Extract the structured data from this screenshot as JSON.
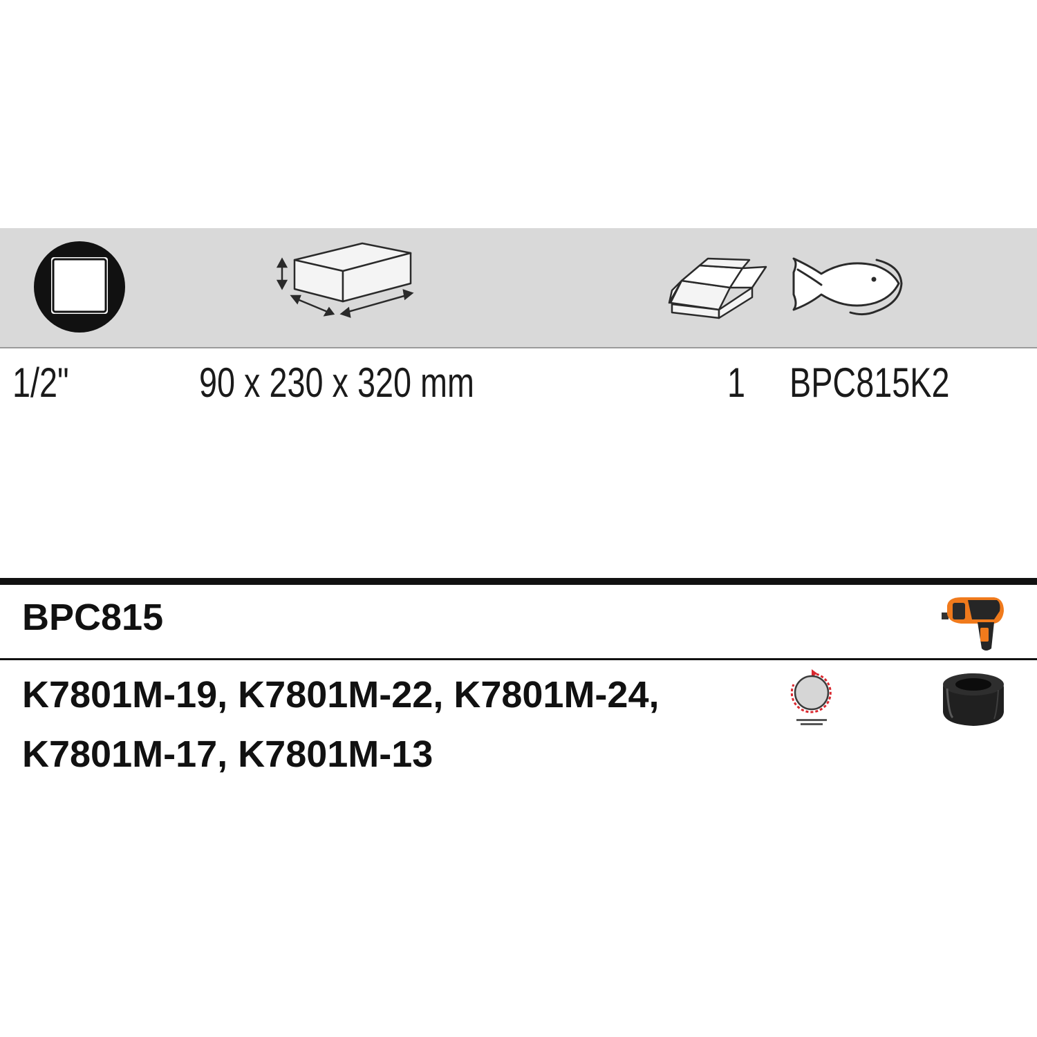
{
  "specs": {
    "drive_size": "1/2\"",
    "dimensions": "90 x 230 x 320 mm",
    "quantity": "1",
    "code": "BPC815K2"
  },
  "icons": {
    "drive": "square-drive-icon",
    "dimensions": "box-dimensions-icon",
    "package": "open-box-icon",
    "material": "fish-outline-icon",
    "tool": "impact-wrench-icon",
    "rotation": "rotation-direction-icon",
    "socket": "impact-socket-icon"
  },
  "colors": {
    "band": "#d9d9d9",
    "wrench_orange": "#f07a1c",
    "rotation_red": "#d9282f"
  },
  "items": {
    "product_code": "BPC815",
    "socket_codes_line1": "K7801M-19, K7801M-22, K7801M-24,",
    "socket_codes_line2": "K7801M-17, K7801M-13"
  }
}
